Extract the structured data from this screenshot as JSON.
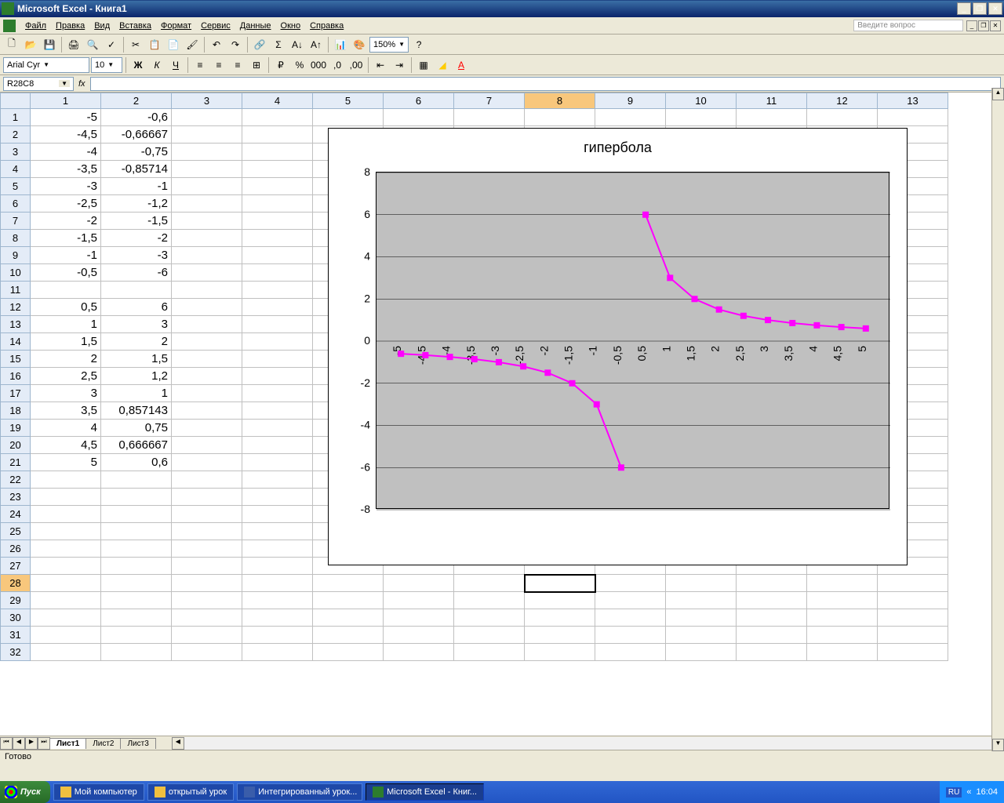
{
  "titlebar": {
    "title": "Microsoft Excel - Книга1"
  },
  "menubar": {
    "items": [
      "Файл",
      "Правка",
      "Вид",
      "Вставка",
      "Формат",
      "Сервис",
      "Данные",
      "Окно",
      "Справка"
    ],
    "question": "Введите вопрос"
  },
  "toolbar1": {
    "zoom": "150%"
  },
  "toolbar2": {
    "font": "Arial Cyr",
    "size": "10"
  },
  "namebox": "R28C8",
  "columns": [
    "1",
    "2",
    "3",
    "4",
    "5",
    "6",
    "7",
    "8",
    "9",
    "10",
    "11",
    "12",
    "13"
  ],
  "selected_col_index": 7,
  "selected_row": 28,
  "rows": [
    {
      "r": "1",
      "c1": "-5",
      "c2": "-0,6"
    },
    {
      "r": "2",
      "c1": "-4,5",
      "c2": "-0,66667"
    },
    {
      "r": "3",
      "c1": "-4",
      "c2": "-0,75"
    },
    {
      "r": "4",
      "c1": "-3,5",
      "c2": "-0,85714"
    },
    {
      "r": "5",
      "c1": "-3",
      "c2": "-1"
    },
    {
      "r": "6",
      "c1": "-2,5",
      "c2": "-1,2"
    },
    {
      "r": "7",
      "c1": "-2",
      "c2": "-1,5"
    },
    {
      "r": "8",
      "c1": "-1,5",
      "c2": "-2"
    },
    {
      "r": "9",
      "c1": "-1",
      "c2": "-3"
    },
    {
      "r": "10",
      "c1": "-0,5",
      "c2": "-6"
    },
    {
      "r": "11",
      "c1": "",
      "c2": ""
    },
    {
      "r": "12",
      "c1": "0,5",
      "c2": "6"
    },
    {
      "r": "13",
      "c1": "1",
      "c2": "3"
    },
    {
      "r": "14",
      "c1": "1,5",
      "c2": "2"
    },
    {
      "r": "15",
      "c1": "2",
      "c2": "1,5"
    },
    {
      "r": "16",
      "c1": "2,5",
      "c2": "1,2"
    },
    {
      "r": "17",
      "c1": "3",
      "c2": "1"
    },
    {
      "r": "18",
      "c1": "3,5",
      "c2": "0,857143"
    },
    {
      "r": "19",
      "c1": "4",
      "c2": "0,75"
    },
    {
      "r": "20",
      "c1": "4,5",
      "c2": "0,666667"
    },
    {
      "r": "21",
      "c1": "5",
      "c2": "0,6"
    },
    {
      "r": "22",
      "c1": "",
      "c2": ""
    },
    {
      "r": "23",
      "c1": "",
      "c2": ""
    },
    {
      "r": "24",
      "c1": "",
      "c2": ""
    },
    {
      "r": "25",
      "c1": "",
      "c2": ""
    },
    {
      "r": "26",
      "c1": "",
      "c2": ""
    },
    {
      "r": "27",
      "c1": "",
      "c2": ""
    },
    {
      "r": "28",
      "c1": "",
      "c2": ""
    },
    {
      "r": "29",
      "c1": "",
      "c2": ""
    },
    {
      "r": "30",
      "c1": "",
      "c2": ""
    },
    {
      "r": "31",
      "c1": "",
      "c2": ""
    },
    {
      "r": "32",
      "c1": "",
      "c2": ""
    }
  ],
  "chart_data": {
    "type": "line",
    "title": "гипербола",
    "categories": [
      "-5",
      "-4,5",
      "-4",
      "-3,5",
      "-3",
      "-2,5",
      "-2",
      "-1,5",
      "-1",
      "-0,5",
      "0,5",
      "1",
      "1,5",
      "2",
      "2,5",
      "3",
      "3,5",
      "4",
      "4,5",
      "5"
    ],
    "series": [
      {
        "name": "",
        "values": [
          -0.6,
          -0.66667,
          -0.75,
          -0.85714,
          -1,
          -1.2,
          -1.5,
          -2,
          -3,
          -6,
          6,
          3,
          2,
          1.5,
          1.2,
          1,
          0.857143,
          0.75,
          0.666667,
          0.6
        ]
      }
    ],
    "ylim": [
      -8,
      8
    ],
    "yticks": [
      -8,
      -6,
      -4,
      -2,
      0,
      2,
      4,
      6,
      8
    ],
    "xlabel": "",
    "ylabel": ""
  },
  "tabs": [
    "Лист1",
    "Лист2",
    "Лист3"
  ],
  "active_tab": 0,
  "status": "Готово",
  "taskbar": {
    "start": "Пуск",
    "items": [
      "Мой компьютер",
      "открытый урок",
      "Интегрированный урок...",
      "Microsoft Excel - Книг..."
    ],
    "active_item": 3,
    "lang": "RU",
    "time": "16:04"
  }
}
